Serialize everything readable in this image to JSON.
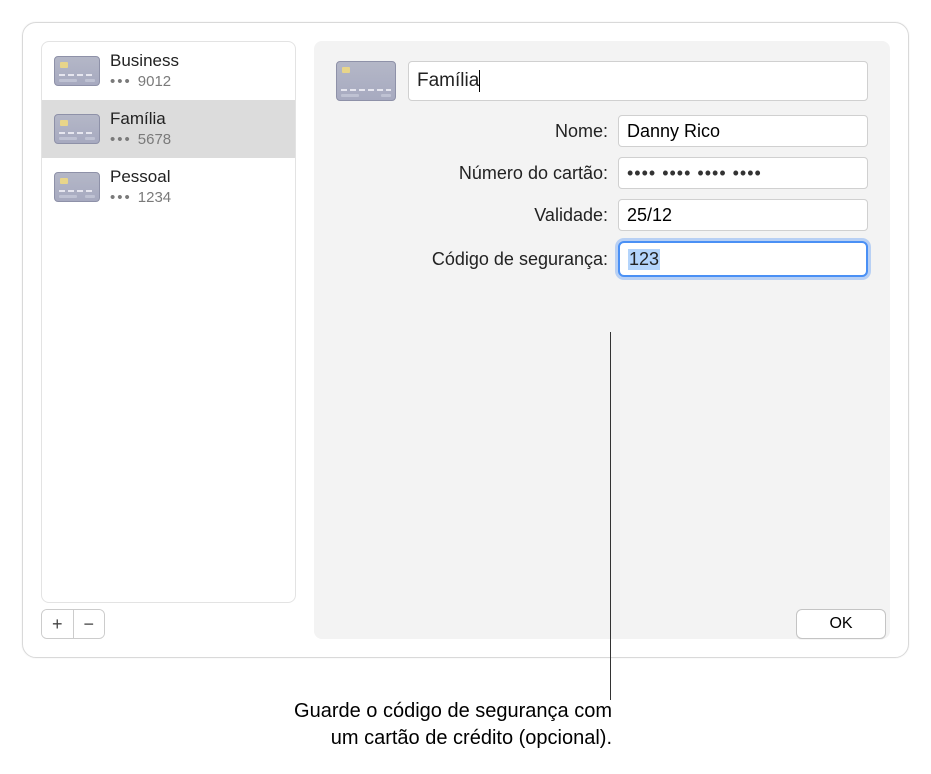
{
  "sidebar": {
    "items": [
      {
        "title": "Business",
        "last4": "9012",
        "selected": false
      },
      {
        "title": "Família",
        "last4": "5678",
        "selected": true
      },
      {
        "title": "Pessoal",
        "last4": "1234",
        "selected": false
      }
    ]
  },
  "detail": {
    "card_label_value": "Família",
    "fields": {
      "name": {
        "label": "Nome:",
        "value": "Danny Rico"
      },
      "number": {
        "label": "Número do cartão:",
        "value_masked": "•••• •••• •••• ••••"
      },
      "expiry": {
        "label": "Validade:",
        "value": "25/12"
      },
      "cvv": {
        "label": "Código de segurança:",
        "value": "123"
      }
    }
  },
  "buttons": {
    "add": "+",
    "remove": "−",
    "ok": "OK"
  },
  "callout": {
    "line1": "Guarde o código de segurança com",
    "line2": "um cartão de crédito (opcional)."
  }
}
